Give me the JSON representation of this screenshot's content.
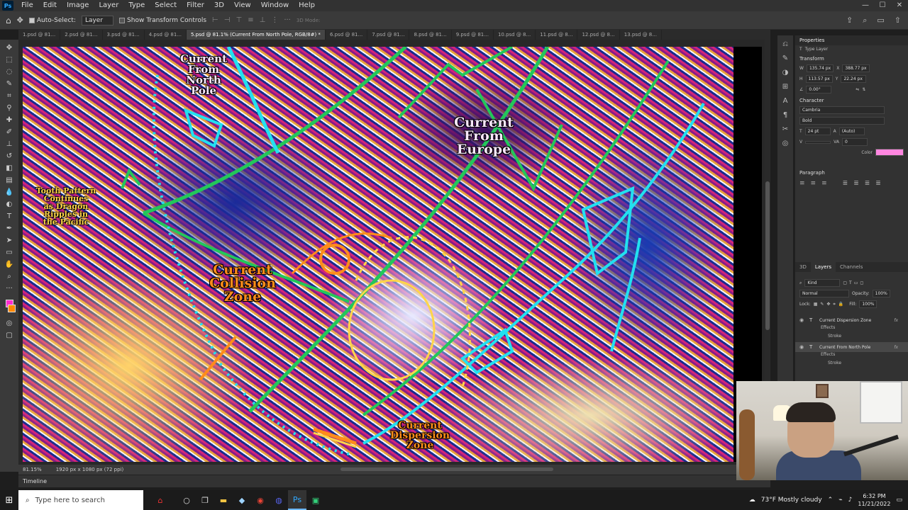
{
  "menu": {
    "logo": "Ps",
    "items": [
      "File",
      "Edit",
      "Image",
      "Layer",
      "Type",
      "Select",
      "Filter",
      "3D",
      "View",
      "Window",
      "Help"
    ],
    "window_controls": [
      "—",
      "☐",
      "✕"
    ]
  },
  "options": {
    "auto_select_label": "Auto-Select:",
    "auto_select_target": "Layer",
    "show_transform_label": "Show Transform Controls",
    "mode_3d": "3D Mode:"
  },
  "tabs": [
    {
      "label": "1.psd @ 81...",
      "active": false
    },
    {
      "label": "2.psd @ 81...",
      "active": false
    },
    {
      "label": "3.psd @ 81...",
      "active": false
    },
    {
      "label": "4.psd @ 81...",
      "active": false
    },
    {
      "label": "5.psd @ 81.1% (Current From North Pole, RGB/8#) *",
      "active": true
    },
    {
      "label": "6.psd @ 81...",
      "active": false
    },
    {
      "label": "7.psd @ 81...",
      "active": false
    },
    {
      "label": "8.psd @ 81...",
      "active": false
    },
    {
      "label": "9.psd @ 81...",
      "active": false
    },
    {
      "label": "10.psd @ 8...",
      "active": false
    },
    {
      "label": "11.psd @ 8...",
      "active": false
    },
    {
      "label": "12.psd @ 8...",
      "active": false
    },
    {
      "label": "13.psd @ 8...",
      "active": false
    }
  ],
  "canvas_labels": {
    "north_pole": "Current\nFrom\nNorth\nPole",
    "europe": "Current\nFrom\nEurope",
    "collision": "Current\nCollision\nZone",
    "dispersion": "Current\nDispersion\nZone",
    "tooth": "Tooth Pattern\nContinues\nas Dragon\nRipples in\nthe Pacific"
  },
  "status": {
    "zoom": "81.15%",
    "doc_size": "1920 px x 1080 px (72 ppi)"
  },
  "timeline": {
    "label": "Timeline"
  },
  "properties": {
    "title": "Properties",
    "layer_type": "Type Layer",
    "transform_title": "Transform",
    "w": "135.74 px",
    "x": "388.77 px",
    "h": "113.57 px",
    "y": "22.24 px",
    "angle": "0.00°",
    "character_title": "Character",
    "font": "Cambria",
    "style": "Bold",
    "size": "24 pt",
    "leading": "(Auto)",
    "tracking": "0",
    "color_label": "Color",
    "color": "#ff86e0",
    "paragraph_title": "Paragraph"
  },
  "layers": {
    "tabs": [
      "3D",
      "Layers",
      "Channels"
    ],
    "active_tab": "Layers",
    "kind": "Kind",
    "blend": "Normal",
    "opacity_label": "Opacity:",
    "opacity": "100%",
    "lock_label": "Lock:",
    "fill_label": "Fill:",
    "fill": "100%",
    "items": [
      {
        "name": "Current Dispersion Zone",
        "effects": "Effects",
        "stroke": "Stroke"
      },
      {
        "name": "Current From North Pole",
        "effects": "Effects",
        "stroke": "Stroke"
      }
    ],
    "fx": "fx"
  },
  "taskbar": {
    "search_placeholder": "Type here to search",
    "weather": "73°F  Mostly cloudy",
    "time": "6:32 PM",
    "date": "11/21/2022"
  }
}
